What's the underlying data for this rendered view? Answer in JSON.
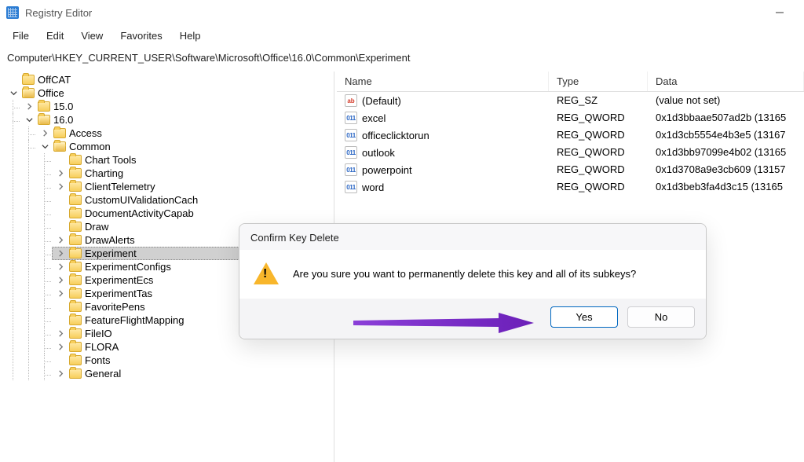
{
  "window": {
    "title": "Registry Editor"
  },
  "menu": [
    "File",
    "Edit",
    "View",
    "Favorites",
    "Help"
  ],
  "address": "Computer\\HKEY_CURRENT_USER\\Software\\Microsoft\\Office\\16.0\\Common\\Experiment",
  "tree": {
    "root": [
      {
        "label": "OffCAT",
        "expand": "none"
      },
      {
        "label": "Office",
        "expand": "open",
        "children": [
          {
            "label": "15.0",
            "expand": "closed"
          },
          {
            "label": "16.0",
            "expand": "open",
            "children": [
              {
                "label": "Access",
                "expand": "closed"
              },
              {
                "label": "Common",
                "expand": "open",
                "children": [
                  {
                    "label": "Chart Tools",
                    "expand": "none"
                  },
                  {
                    "label": "Charting",
                    "expand": "closed"
                  },
                  {
                    "label": "ClientTelemetry",
                    "expand": "closed"
                  },
                  {
                    "label": "CustomUIValidationCach",
                    "expand": "none"
                  },
                  {
                    "label": "DocumentActivityCapab",
                    "expand": "none"
                  },
                  {
                    "label": "Draw",
                    "expand": "none"
                  },
                  {
                    "label": "DrawAlerts",
                    "expand": "closed"
                  },
                  {
                    "label": "Experiment",
                    "expand": "closed",
                    "selected": true
                  },
                  {
                    "label": "ExperimentConfigs",
                    "expand": "closed"
                  },
                  {
                    "label": "ExperimentEcs",
                    "expand": "closed"
                  },
                  {
                    "label": "ExperimentTas",
                    "expand": "closed"
                  },
                  {
                    "label": "FavoritePens",
                    "expand": "none"
                  },
                  {
                    "label": "FeatureFlightMapping",
                    "expand": "none"
                  },
                  {
                    "label": "FileIO",
                    "expand": "closed"
                  },
                  {
                    "label": "FLORA",
                    "expand": "closed"
                  },
                  {
                    "label": "Fonts",
                    "expand": "none"
                  },
                  {
                    "label": "General",
                    "expand": "closed"
                  }
                ]
              }
            ]
          }
        ]
      }
    ]
  },
  "columns": {
    "name": "Name",
    "type": "Type",
    "data": "Data"
  },
  "values": [
    {
      "icon": "str",
      "name": "(Default)",
      "type": "REG_SZ",
      "data": "(value not set)"
    },
    {
      "icon": "bin",
      "name": "excel",
      "type": "REG_QWORD",
      "data": "0x1d3bbaae507ad2b (13165"
    },
    {
      "icon": "bin",
      "name": "officeclicktorun",
      "type": "REG_QWORD",
      "data": "0x1d3cb5554e4b3e5 (13167"
    },
    {
      "icon": "bin",
      "name": "outlook",
      "type": "REG_QWORD",
      "data": "0x1d3bb97099e4b02 (13165"
    },
    {
      "icon": "bin",
      "name": "powerpoint",
      "type": "REG_QWORD",
      "data": "0x1d3708a9e3cb609 (13157"
    },
    {
      "icon": "bin",
      "name": "word",
      "type": "REG_QWORD",
      "data": "0x1d3beb3fa4d3c15 (13165"
    }
  ],
  "dialog": {
    "title": "Confirm Key Delete",
    "message": "Are you sure you want to permanently delete this key and all of its subkeys?",
    "yes": "Yes",
    "no": "No"
  }
}
